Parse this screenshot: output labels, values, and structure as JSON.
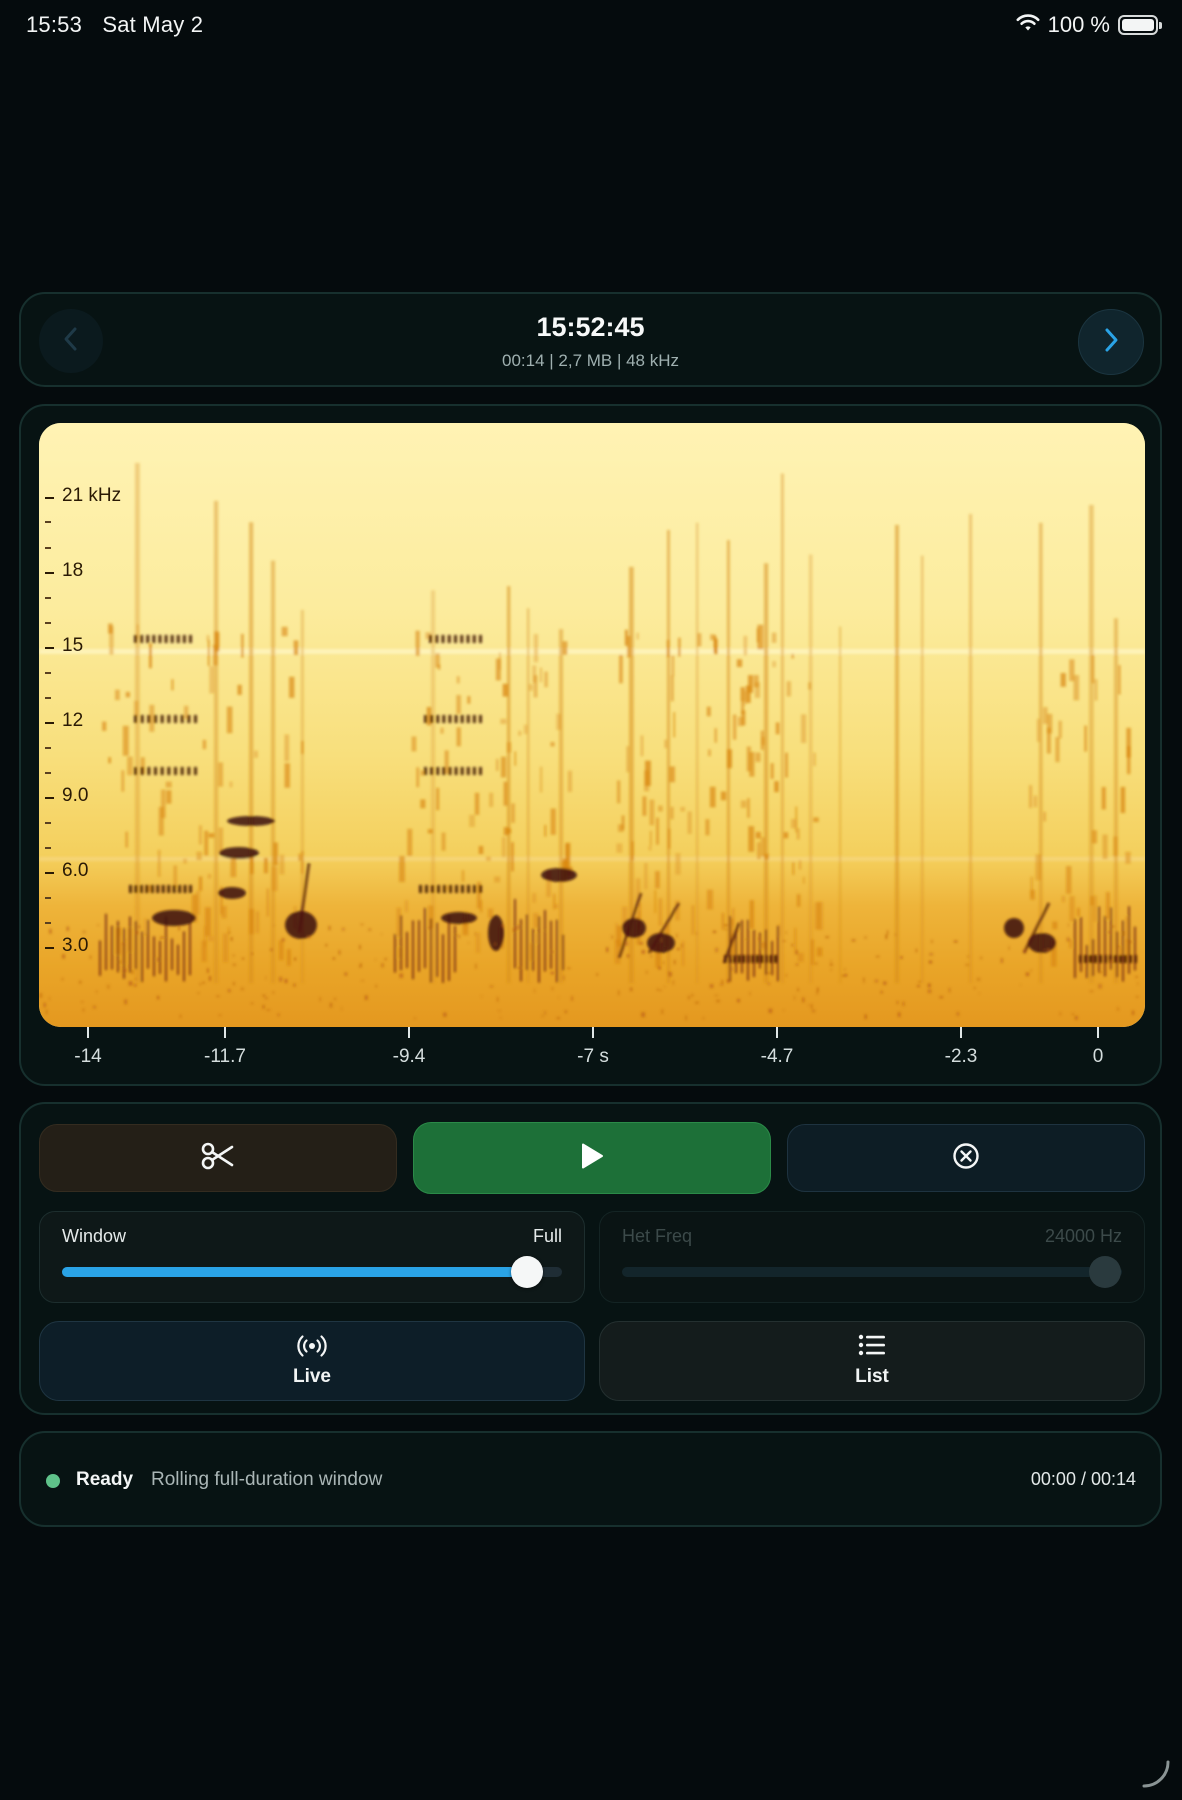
{
  "status_bar": {
    "time": "15:53",
    "date": "Sat May 2",
    "battery": "100 %",
    "wifi_icon": "wifi-icon",
    "battery_icon": "battery-icon"
  },
  "recording": {
    "title": "15:52:45",
    "meta": "00:14 | 2,7 MB | 48 kHz",
    "prev_icon": "chevron-left-icon",
    "next_icon": "chevron-right-icon"
  },
  "spectrogram": {
    "y_labels": [
      "21 kHz",
      "18",
      "15",
      "12",
      "9.0",
      "6.0",
      "3.0"
    ],
    "x_labels": [
      "-14",
      "-11.7",
      "-9.4",
      "-7 s",
      "-4.7",
      "-2.3",
      "0"
    ],
    "colors": {
      "background": "#fdeea6",
      "mid": "#e6a21c",
      "dark": "#3a0a08"
    }
  },
  "controls": {
    "cut_icon": "scissors-icon",
    "play_icon": "play-icon",
    "clear_icon": "circle-x-icon",
    "window": {
      "label": "Window",
      "value": "Full",
      "fraction": 1.0
    },
    "het_freq": {
      "label": "Het Freq",
      "value": "24000 Hz",
      "fraction": 1.0,
      "disabled": true
    },
    "live": {
      "label": "Live",
      "icon": "broadcast-icon"
    },
    "list": {
      "label": "List",
      "icon": "list-icon"
    }
  },
  "status": {
    "state": "Ready",
    "message": "Rolling full-duration window",
    "time": "00:00 / 00:14"
  },
  "accent_colors": {
    "play": "#1d7038",
    "slider": "#2aa3e6",
    "ready_dot": "#5fc28a"
  }
}
